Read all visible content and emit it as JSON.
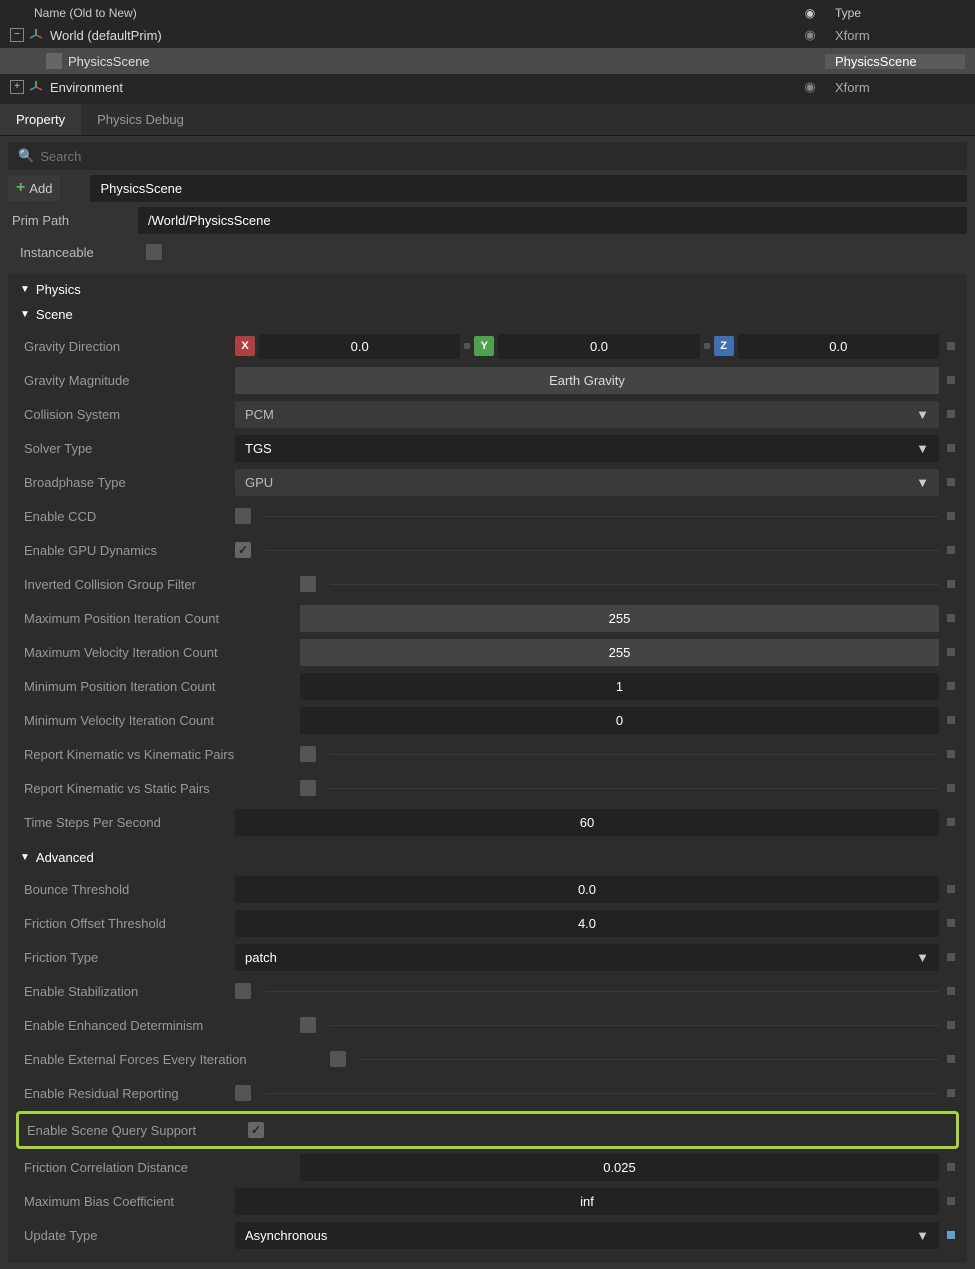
{
  "tree": {
    "header_name": "Name (Old to New)",
    "header_type": "Type",
    "rows": [
      {
        "expand": "-",
        "label": "World (defaultPrim)",
        "type": "Xform",
        "icon": "axis"
      },
      {
        "expand": "",
        "label": "PhysicsScene",
        "type": "PhysicsScene",
        "icon": "cube",
        "selected": true,
        "indent": 1
      },
      {
        "expand": "+",
        "label": "Environment",
        "type": "Xform",
        "icon": "axis"
      }
    ]
  },
  "tabs": {
    "property": "Property",
    "physics_debug": "Physics Debug"
  },
  "search_placeholder": "Search",
  "add_btn": "Add",
  "name_value": "PhysicsScene",
  "prim_path_label": "Prim Path",
  "prim_path_value": "/World/PhysicsScene",
  "instanceable_label": "Instanceable",
  "physics": {
    "title": "Physics",
    "scene": {
      "title": "Scene",
      "gravity_direction": {
        "label": "Gravity Direction",
        "x": "0.0",
        "y": "0.0",
        "z": "0.0"
      },
      "gravity_magnitude": {
        "label": "Gravity Magnitude",
        "value": "Earth Gravity"
      },
      "collision_system": {
        "label": "Collision System",
        "value": "PCM"
      },
      "solver_type": {
        "label": "Solver Type",
        "value": "TGS"
      },
      "broadphase_type": {
        "label": "Broadphase Type",
        "value": "GPU"
      },
      "enable_ccd": {
        "label": "Enable CCD",
        "checked": false
      },
      "enable_gpu_dynamics": {
        "label": "Enable GPU Dynamics",
        "checked": true
      },
      "inverted_collision_group_filter": {
        "label": "Inverted Collision Group Filter",
        "checked": false
      },
      "max_pos_iter": {
        "label": "Maximum Position Iteration Count",
        "value": "255"
      },
      "max_vel_iter": {
        "label": "Maximum Velocity Iteration Count",
        "value": "255"
      },
      "min_pos_iter": {
        "label": "Minimum Position Iteration Count",
        "value": "1"
      },
      "min_vel_iter": {
        "label": "Minimum Velocity Iteration Count",
        "value": "0"
      },
      "report_kin_kin": {
        "label": "Report Kinematic vs Kinematic Pairs",
        "checked": false
      },
      "report_kin_static": {
        "label": "Report Kinematic vs Static Pairs",
        "checked": false
      },
      "time_steps": {
        "label": "Time Steps Per Second",
        "value": "60"
      }
    },
    "advanced": {
      "title": "Advanced",
      "bounce_threshold": {
        "label": "Bounce Threshold",
        "value": "0.0"
      },
      "friction_offset_threshold": {
        "label": "Friction Offset Threshold",
        "value": "4.0"
      },
      "friction_type": {
        "label": "Friction Type",
        "value": "patch"
      },
      "enable_stabilization": {
        "label": "Enable Stabilization",
        "checked": false
      },
      "enable_enhanced_determinism": {
        "label": "Enable Enhanced Determinism",
        "checked": false
      },
      "enable_external_forces": {
        "label": "Enable External Forces Every Iteration",
        "checked": false
      },
      "enable_residual_reporting": {
        "label": "Enable Residual Reporting",
        "checked": false
      },
      "enable_scene_query": {
        "label": "Enable Scene Query Support",
        "checked": true
      },
      "friction_correlation_distance": {
        "label": "Friction Correlation Distance",
        "value": "0.025"
      },
      "maximum_bias_coefficient": {
        "label": "Maximum Bias Coefficient",
        "value": "inf"
      },
      "update_type": {
        "label": "Update Type",
        "value": "Asynchronous"
      }
    }
  }
}
